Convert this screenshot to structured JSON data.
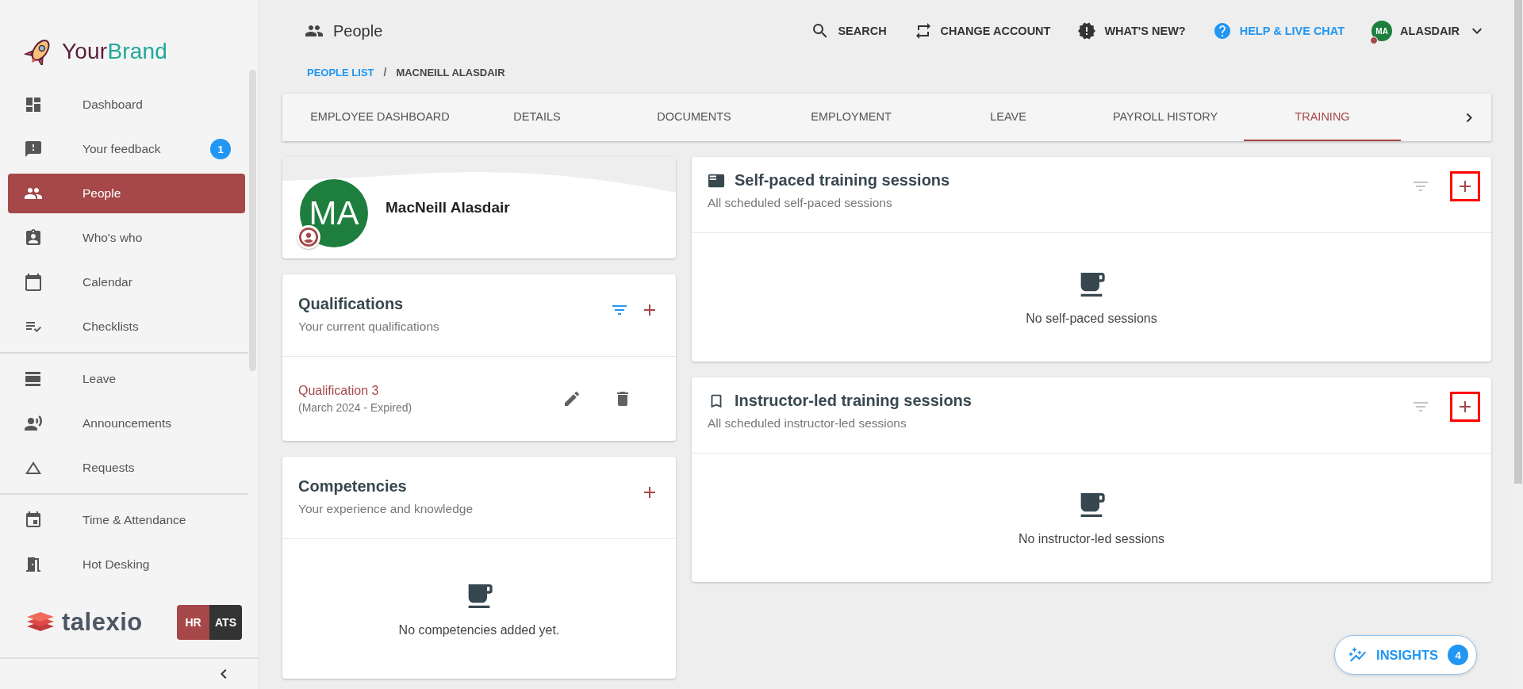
{
  "brand": {
    "name_first": "Your",
    "name_second": "Brand"
  },
  "sidebar": {
    "groups": [
      {
        "items": [
          {
            "kind": "dashboard",
            "label": "Dashboard",
            "selected": false
          },
          {
            "kind": "feedback",
            "label": "Your feedback",
            "badge": "1",
            "selected": false
          },
          {
            "kind": "people",
            "label": "People",
            "selected": true
          },
          {
            "kind": "whoswho",
            "label": "Who's who",
            "selected": false
          },
          {
            "kind": "calendar",
            "label": "Calendar",
            "selected": false
          },
          {
            "kind": "checklists",
            "label": "Checklists",
            "selected": false
          }
        ]
      },
      {
        "items": [
          {
            "kind": "leave",
            "label": "Leave",
            "selected": false
          },
          {
            "kind": "announcements",
            "label": "Announcements",
            "selected": false
          },
          {
            "kind": "requests",
            "label": "Requests",
            "selected": false
          }
        ]
      },
      {
        "items": [
          {
            "kind": "time",
            "label": "Time & Attendance",
            "selected": false
          },
          {
            "kind": "desk",
            "label": "Hot Desking",
            "selected": false
          }
        ]
      }
    ],
    "footer_logo": "talexio",
    "modes": [
      {
        "label": "HR",
        "selected": true
      },
      {
        "label": "ATS",
        "selected": false
      }
    ]
  },
  "header": {
    "title": "People",
    "actions": [
      {
        "kind": "search",
        "label": "SEARCH"
      },
      {
        "kind": "switch",
        "label": "CHANGE ACCOUNT"
      },
      {
        "kind": "news",
        "label": "WHAT'S NEW?"
      },
      {
        "kind": "help",
        "label": "HELP & LIVE CHAT"
      }
    ],
    "user": {
      "initials": "MA",
      "name": "ALASDAIR"
    }
  },
  "breadcrumb_separator": "/",
  "breadcrumb": [
    {
      "label": "PEOPLE LIST",
      "link": true
    },
    {
      "label": "MACNEILL ALASDAIR",
      "link": false
    }
  ],
  "tabs": [
    {
      "label": "EMPLOYEE DASHBOARD",
      "selected": false
    },
    {
      "label": "DETAILS",
      "selected": false
    },
    {
      "label": "DOCUMENTS",
      "selected": false
    },
    {
      "label": "EMPLOYMENT",
      "selected": false
    },
    {
      "label": "LEAVE",
      "selected": false
    },
    {
      "label": "PAYROLL HISTORY",
      "selected": false
    },
    {
      "label": "TRAINING",
      "selected": true
    }
  ],
  "profile": {
    "initials": "MA",
    "name": "MacNeill Alasdair"
  },
  "qualifications": {
    "title": "Qualifications",
    "subtitle": "Your current qualifications",
    "filter_active": true,
    "items": [
      {
        "title": "Qualification 3",
        "detail": "(March 2024 - Expired)"
      }
    ]
  },
  "competencies": {
    "title": "Competencies",
    "subtitle": "Your experience and knowledge",
    "empty": "No competencies added yet."
  },
  "sessions": [
    {
      "kind": "self",
      "title": "Self-paced training sessions",
      "subtitle": "All scheduled self-paced sessions",
      "empty": "No self-paced sessions",
      "filter_active": false,
      "highlighted": true
    },
    {
      "kind": "instructor",
      "title": "Instructor-led training sessions",
      "subtitle": "All scheduled instructor-led sessions",
      "empty": "No instructor-led sessions",
      "filter_active": false,
      "highlighted": true
    }
  ],
  "insights": {
    "label": "INSIGHTS",
    "count": "4"
  }
}
